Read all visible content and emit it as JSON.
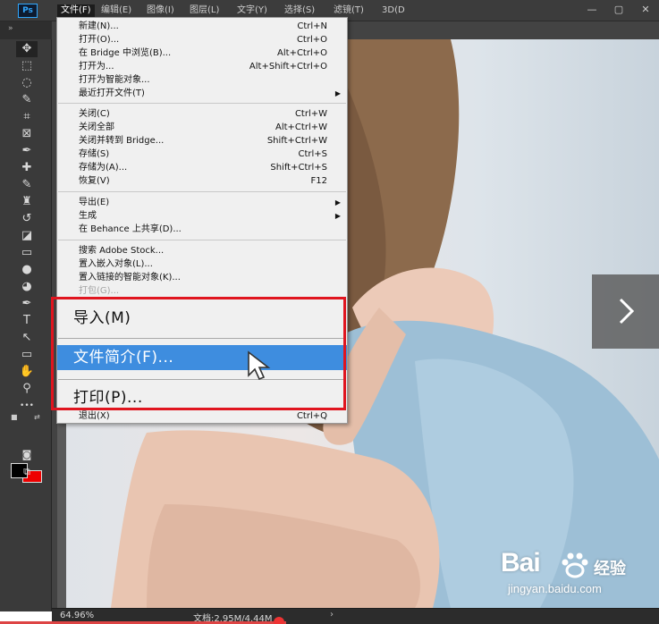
{
  "app": {
    "logo": "Ps"
  },
  "menubar": {
    "items": [
      {
        "label": "文件(F)",
        "active": true
      },
      {
        "label": "编辑(E)"
      },
      {
        "label": "图像(I)"
      },
      {
        "label": "图层(L)"
      },
      {
        "label": "文字(Y)"
      },
      {
        "label": "选择(S)"
      },
      {
        "label": "滤镜(T)"
      },
      {
        "label": "3D(D"
      }
    ],
    "window_controls": [
      "—",
      "▢",
      "✕"
    ]
  },
  "file_menu": {
    "items": [
      {
        "label": "新建(N)...",
        "shortcut": "Ctrl+N"
      },
      {
        "label": "打开(O)...",
        "shortcut": "Ctrl+O"
      },
      {
        "label": "在 Bridge 中浏览(B)...",
        "shortcut": "Alt+Ctrl+O"
      },
      {
        "label": "打开为...",
        "shortcut": "Alt+Shift+Ctrl+O"
      },
      {
        "label": "打开为智能对象...",
        "shortcut": ""
      },
      {
        "label": "最近打开文件(T)",
        "shortcut": "",
        "submenu": true
      },
      {
        "label": "关闭(C)",
        "shortcut": "Ctrl+W"
      },
      {
        "label": "关闭全部",
        "shortcut": "Alt+Ctrl+W"
      },
      {
        "label": "关闭并转到 Bridge...",
        "shortcut": "Shift+Ctrl+W"
      },
      {
        "label": "存储(S)",
        "shortcut": "Ctrl+S"
      },
      {
        "label": "存储为(A)...",
        "shortcut": "Shift+Ctrl+S"
      },
      {
        "label": "恢复(V)",
        "shortcut": "F12"
      },
      {
        "label": "导出(E)",
        "shortcut": "",
        "submenu": true
      },
      {
        "label": "生成",
        "shortcut": "",
        "submenu": true
      },
      {
        "label": "在 Behance 上共享(D)...",
        "shortcut": ""
      },
      {
        "label": "搜索 Adobe Stock...",
        "shortcut": ""
      },
      {
        "label": "置入嵌入对象(L)...",
        "shortcut": ""
      },
      {
        "label": "置入链接的智能对象(K)...",
        "shortcut": ""
      },
      {
        "label": "打包(G)...",
        "shortcut": "",
        "disabled": true
      },
      {
        "label": "退出(X)",
        "shortcut": "Ctrl+Q"
      }
    ],
    "zoomed_items": [
      {
        "label": "导入(M)"
      },
      {
        "label": "文件简介(F)...",
        "highlighted": true
      },
      {
        "label": "打印(P)..."
      }
    ],
    "submenu_glyph": "▶"
  },
  "tools": [
    {
      "name": "move-tool",
      "glyph": "✥"
    },
    {
      "name": "marquee-tool",
      "glyph": "⬚"
    },
    {
      "name": "lasso-tool",
      "glyph": "◌"
    },
    {
      "name": "quick-select-tool",
      "glyph": "✎"
    },
    {
      "name": "crop-tool",
      "glyph": "⌗"
    },
    {
      "name": "frame-tool",
      "glyph": "⊠"
    },
    {
      "name": "eyedropper-tool",
      "glyph": "✒"
    },
    {
      "name": "healing-brush-tool",
      "glyph": "✚"
    },
    {
      "name": "brush-tool",
      "glyph": "✎"
    },
    {
      "name": "stamp-tool",
      "glyph": "♜"
    },
    {
      "name": "history-brush-tool",
      "glyph": "↺"
    },
    {
      "name": "eraser-tool",
      "glyph": "◪"
    },
    {
      "name": "gradient-tool",
      "glyph": "▭"
    },
    {
      "name": "blur-tool",
      "glyph": "●"
    },
    {
      "name": "dodge-tool",
      "glyph": "◕"
    },
    {
      "name": "pen-tool",
      "glyph": "✒"
    },
    {
      "name": "type-tool",
      "glyph": "T"
    },
    {
      "name": "path-select-tool",
      "glyph": "↖"
    },
    {
      "name": "rectangle-tool",
      "glyph": "▭"
    },
    {
      "name": "hand-tool",
      "glyph": "✋"
    },
    {
      "name": "zoom-tool",
      "glyph": "⚲"
    },
    {
      "name": "more-tools",
      "glyph": "•••"
    }
  ],
  "colors": {
    "foreground": "#000000",
    "background": "#e00000",
    "highlight": "#3e8ddf",
    "callout": "#e0151f"
  },
  "status": {
    "zoom": "64.96%",
    "doc": "文档:2.95M/4.44M",
    "arrow": "›"
  },
  "watermark": {
    "logo": "Bai",
    "brand": "经验",
    "url": "jingyan.baidu.com"
  }
}
